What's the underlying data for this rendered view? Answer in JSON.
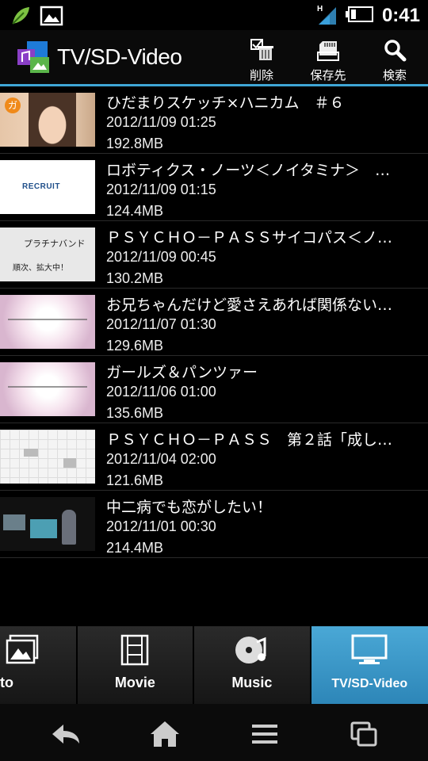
{
  "status": {
    "time": "0:41",
    "network": "H"
  },
  "appbar": {
    "title": "TV/SD-Video"
  },
  "actions": {
    "delete": "削除",
    "save": "保存先",
    "search": "検索"
  },
  "videos": [
    {
      "title": "ひだまりスケッチ×ハニカム　＃６",
      "datetime": "2012/11/09 01:25",
      "size": "192.8MB",
      "badge": "ガ"
    },
    {
      "title": "ロボティクス・ノーツ＜ノイタミナ＞　…",
      "datetime": "2012/11/09 01:15",
      "size": "124.4MB",
      "thumb_text": "RECRUIT"
    },
    {
      "title": "ＰＳＹＣＨＯ－ＰＡＳＳサイコパス＜ノ…",
      "datetime": "2012/11/09 00:45",
      "size": "130.2MB",
      "thumb_text": [
        "プラチナバンド",
        "順次、拡大中！"
      ]
    },
    {
      "title": "お兄ちゃんだけど愛さえあれば関係ない…",
      "datetime": "2012/11/07 01:30",
      "size": "129.6MB"
    },
    {
      "title": "ガールズ＆パンツァー",
      "datetime": "2012/11/06 01:00",
      "size": "135.6MB"
    },
    {
      "title": "ＰＳＹＣＨＯ－ＰＡＳＳ　第２話「成し…",
      "datetime": "2012/11/04 02:00",
      "size": "121.6MB"
    },
    {
      "title": "中二病でも恋がしたい！",
      "datetime": "2012/11/01 00:30",
      "size": "214.4MB"
    }
  ],
  "tabs": [
    {
      "label": "Photo"
    },
    {
      "label": "Movie"
    },
    {
      "label": "Music"
    },
    {
      "label": "TV/SD-Video"
    }
  ],
  "icons": {
    "nav": [
      "back-icon",
      "home-icon",
      "menu-icon",
      "recent-apps-icon"
    ]
  },
  "colors": {
    "accent": "#3fa6d6",
    "active_tab": "#3a97c7"
  }
}
